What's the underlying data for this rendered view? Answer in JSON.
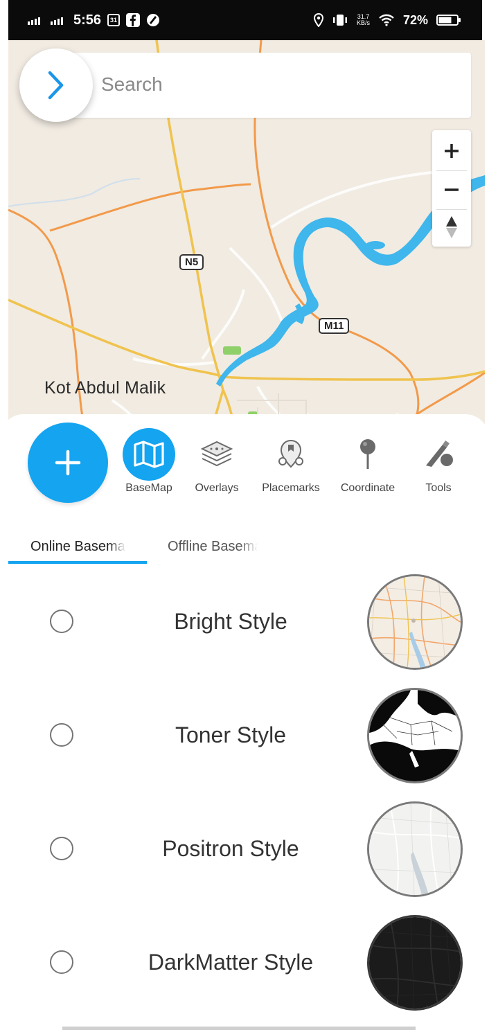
{
  "status_bar": {
    "time": "5:56",
    "calendar_day": "31",
    "net_speed_value": "31.7",
    "net_speed_unit": "KB/s",
    "battery": "72%",
    "battery_level": 0.72
  },
  "map": {
    "search_placeholder": "Search",
    "place_label": "Kot Abdul Malik",
    "road_shields": [
      "N5",
      "M11"
    ],
    "colors": {
      "land": "#f1ebe2",
      "water": "#3fb6ec",
      "major_road": "#f0c34e",
      "secondary_road": "#f29a4a"
    }
  },
  "toolbar": {
    "add_icon": "plus-icon",
    "items": [
      {
        "label": "BaseMap",
        "icon": "map-icon",
        "active": true
      },
      {
        "label": "Overlays",
        "icon": "layers-icon",
        "active": false
      },
      {
        "label": "Placemarks",
        "icon": "placemarks-icon",
        "active": false
      },
      {
        "label": "Coordinate",
        "icon": "pin-icon",
        "active": false
      },
      {
        "label": "Tools",
        "icon": "tools-icon",
        "active": false
      }
    ]
  },
  "tabs": [
    {
      "label": "Online Basemaps",
      "active": true
    },
    {
      "label": "Offline Basemaps",
      "active": false
    }
  ],
  "basemap_styles": [
    {
      "label": "Bright Style",
      "selected": false
    },
    {
      "label": "Toner Style",
      "selected": false
    },
    {
      "label": "Positron Style",
      "selected": false
    },
    {
      "label": "DarkMatter Style",
      "selected": false
    }
  ],
  "accent_color": "#14a4f0"
}
